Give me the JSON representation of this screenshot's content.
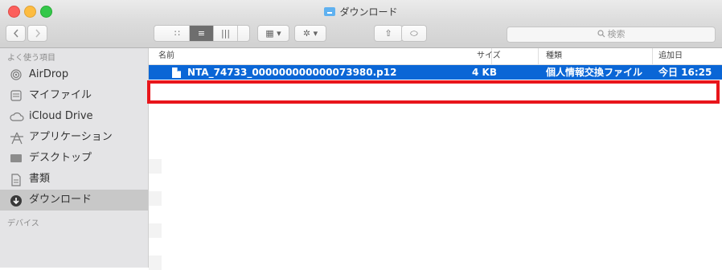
{
  "window": {
    "title": "ダウンロード"
  },
  "toolbar": {
    "back_icon": "chevron-left",
    "forward_icon": "chevron-right",
    "view_icons": "∷",
    "view_list": "≡",
    "view_columns": "|||",
    "view_coverflow": "▯▯",
    "arrange_label": "▦ ▾",
    "action_label": "✲ ▾",
    "share_label": "⇧",
    "tag_label": "⬭",
    "search_placeholder": "検索"
  },
  "sidebar": {
    "favorites_header": "よく使う項目",
    "items": [
      {
        "label": "AirDrop",
        "icon": "airdrop-icon",
        "selected": false
      },
      {
        "label": "マイファイル",
        "icon": "myfiles-icon",
        "selected": false
      },
      {
        "label": "iCloud Drive",
        "icon": "cloud-icon",
        "selected": false
      },
      {
        "label": "アプリケーション",
        "icon": "applications-icon",
        "selected": false
      },
      {
        "label": "デスクトップ",
        "icon": "desktop-icon",
        "selected": false
      },
      {
        "label": "書類",
        "icon": "documents-icon",
        "selected": false
      },
      {
        "label": "ダウンロード",
        "icon": "downloads-icon",
        "selected": true
      }
    ],
    "devices_header": "デバイス"
  },
  "file_list": {
    "columns": {
      "name": "名前",
      "size": "サイズ",
      "kind": "種類",
      "date_added": "追加日"
    },
    "rows": [
      {
        "name": "NTA_74733_000000000000073980.p12",
        "size": "4 KB",
        "kind": "個人情報交換ファイル",
        "date_added": "今日 16:25",
        "selected": true
      }
    ]
  },
  "colors": {
    "selection": "#0a66d6",
    "highlight_box": "#e8151b",
    "sidebar_bg": "#e4e4e6"
  }
}
